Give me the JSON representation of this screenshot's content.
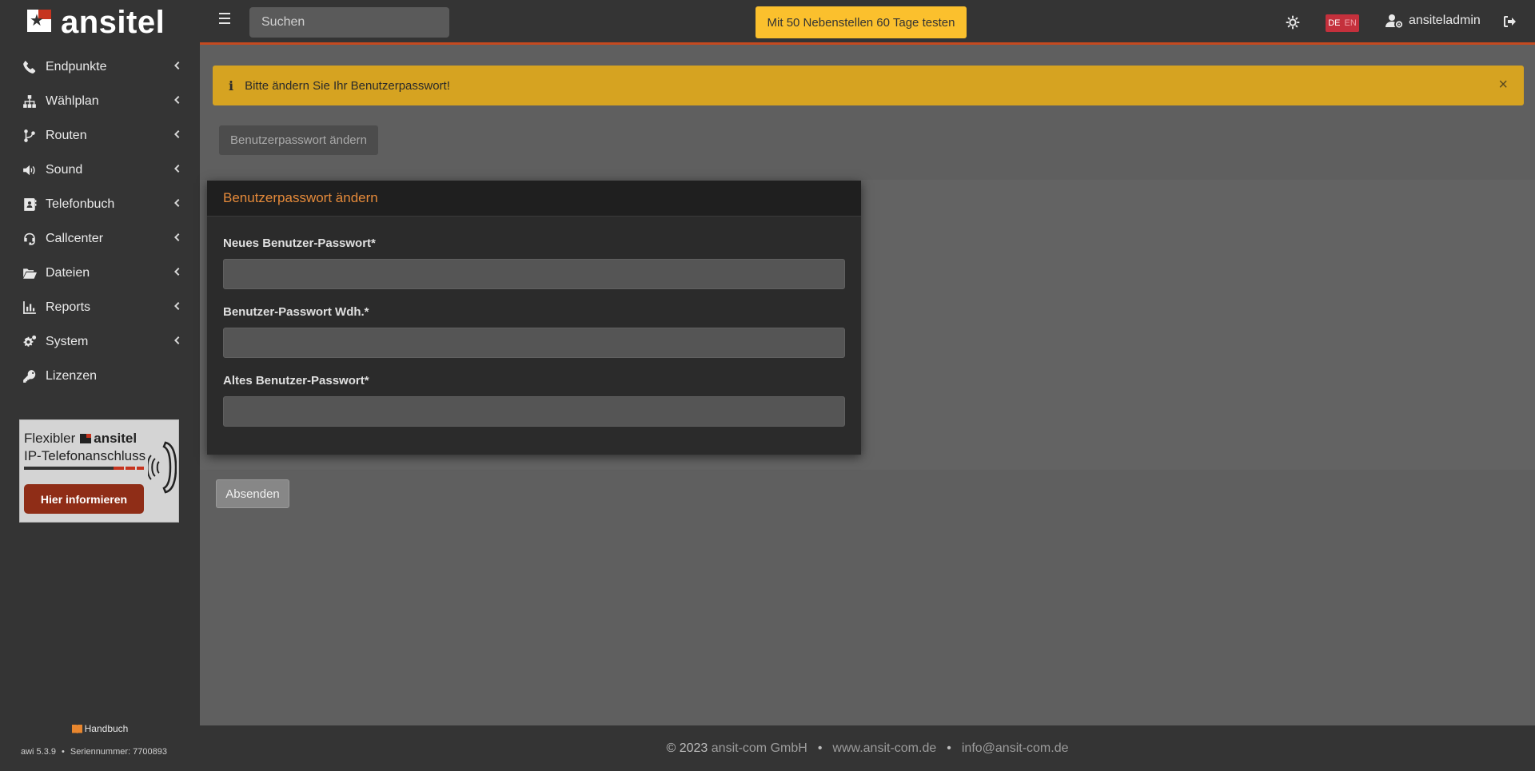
{
  "app": {
    "logo_text": "ansitel"
  },
  "sidebar": {
    "items": [
      {
        "label": "Endpunkte",
        "icon": "phone-icon"
      },
      {
        "label": "Wählplan",
        "icon": "sitemap-icon"
      },
      {
        "label": "Routen",
        "icon": "branch-icon"
      },
      {
        "label": "Sound",
        "icon": "volume-icon"
      },
      {
        "label": "Telefonbuch",
        "icon": "address-book-icon"
      },
      {
        "label": "Callcenter",
        "icon": "headset-icon"
      },
      {
        "label": "Dateien",
        "icon": "folder-open-icon"
      },
      {
        "label": "Reports",
        "icon": "bar-chart-icon"
      },
      {
        "label": "System",
        "icon": "cogs-icon"
      },
      {
        "label": "Lizenzen",
        "icon": "key-icon"
      }
    ],
    "ad": {
      "line1_prefix": "Flexibler",
      "line1_brand": "ansitel",
      "line2": "IP-Telefonanschluss",
      "button": "Hier informieren"
    },
    "handbook": "Handbuch",
    "version": "awi 5.3.9",
    "serial": "Seriennummer: 7700893"
  },
  "topbar": {
    "search_placeholder": "Suchen",
    "promo": "Mit 50 Nebenstellen 60 Tage testen",
    "lang_de": "DE",
    "lang_en": "EN",
    "username": "ansiteladmin"
  },
  "main": {
    "alert": "Bitte ändern Sie Ihr Benutzerpasswort!",
    "alert_close": "×",
    "tab_button": "Benutzerpasswort ändern",
    "card": {
      "title": "Benutzerpasswort ändern",
      "fields": [
        {
          "label": "Neues Benutzer-Passwort*",
          "value": ""
        },
        {
          "label": "Benutzer-Passwort Wdh.*",
          "value": ""
        },
        {
          "label": "Altes Benutzer-Passwort*",
          "value": ""
        }
      ]
    },
    "submit": "Absenden"
  },
  "footer": {
    "copyright_prefix": "© 2023",
    "company": "ansit-com GmbH",
    "website": "www.ansit-com.de",
    "email": "info@ansit-com.de"
  },
  "colors": {
    "accent": "#c44a20",
    "promo": "#fbc02d",
    "alert": "#d6a321",
    "card_title": "#e58a3a"
  }
}
